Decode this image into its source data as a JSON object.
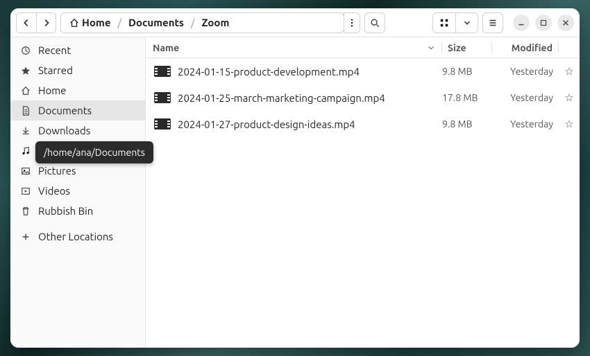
{
  "breadcrumbs": [
    {
      "label": "Home",
      "has_icon": true
    },
    {
      "label": "Documents"
    },
    {
      "label": "Zoom"
    }
  ],
  "tooltip": "/home/ana/Documents",
  "columns": {
    "name": "Name",
    "size": "Size",
    "modified": "Modified"
  },
  "sidebar": [
    {
      "icon": "clock",
      "label": "Recent"
    },
    {
      "icon": "star",
      "label": "Starred"
    },
    {
      "icon": "home",
      "label": "Home"
    },
    {
      "icon": "document",
      "label": "Documents",
      "active": true
    },
    {
      "icon": "download",
      "label": "Downloads"
    },
    {
      "icon": "music",
      "label": "Music"
    },
    {
      "icon": "pictures",
      "label": "Pictures"
    },
    {
      "icon": "videos",
      "label": "Videos"
    },
    {
      "icon": "trash",
      "label": "Rubbish Bin"
    },
    {
      "icon": "plus",
      "label": "Other Locations"
    }
  ],
  "files": [
    {
      "name": "2024-01-15-product-development.mp4",
      "size": "9.8 MB",
      "modified": "Yesterday"
    },
    {
      "name": "2024-01-25-march-marketing-campaign.mp4",
      "size": "17.8 MB",
      "modified": "Yesterday"
    },
    {
      "name": "2024-01-27-product-design-ideas.mp4",
      "size": "9.8 MB",
      "modified": "Yesterday"
    }
  ]
}
